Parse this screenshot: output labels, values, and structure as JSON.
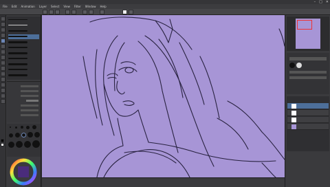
{
  "window": {
    "title": "",
    "controls": [
      "–",
      "□",
      "✕"
    ]
  },
  "menu": {
    "items": [
      "File",
      "Edit",
      "Animation",
      "Layer",
      "Select",
      "View",
      "Filter",
      "Window",
      "Help"
    ]
  },
  "brushes": {
    "items": [
      "",
      "",
      "",
      "",
      "",
      "",
      "",
      "",
      "",
      "",
      ""
    ]
  },
  "layers": {
    "items": [
      {
        "name": ""
      },
      {
        "name": ""
      },
      {
        "name": ""
      },
      {
        "name": ""
      }
    ]
  },
  "colors": {
    "canvas": "#a795d6",
    "panel": "#3a3a3d",
    "accent_red": "#e33",
    "selected_layer": "#4d6f9a"
  }
}
